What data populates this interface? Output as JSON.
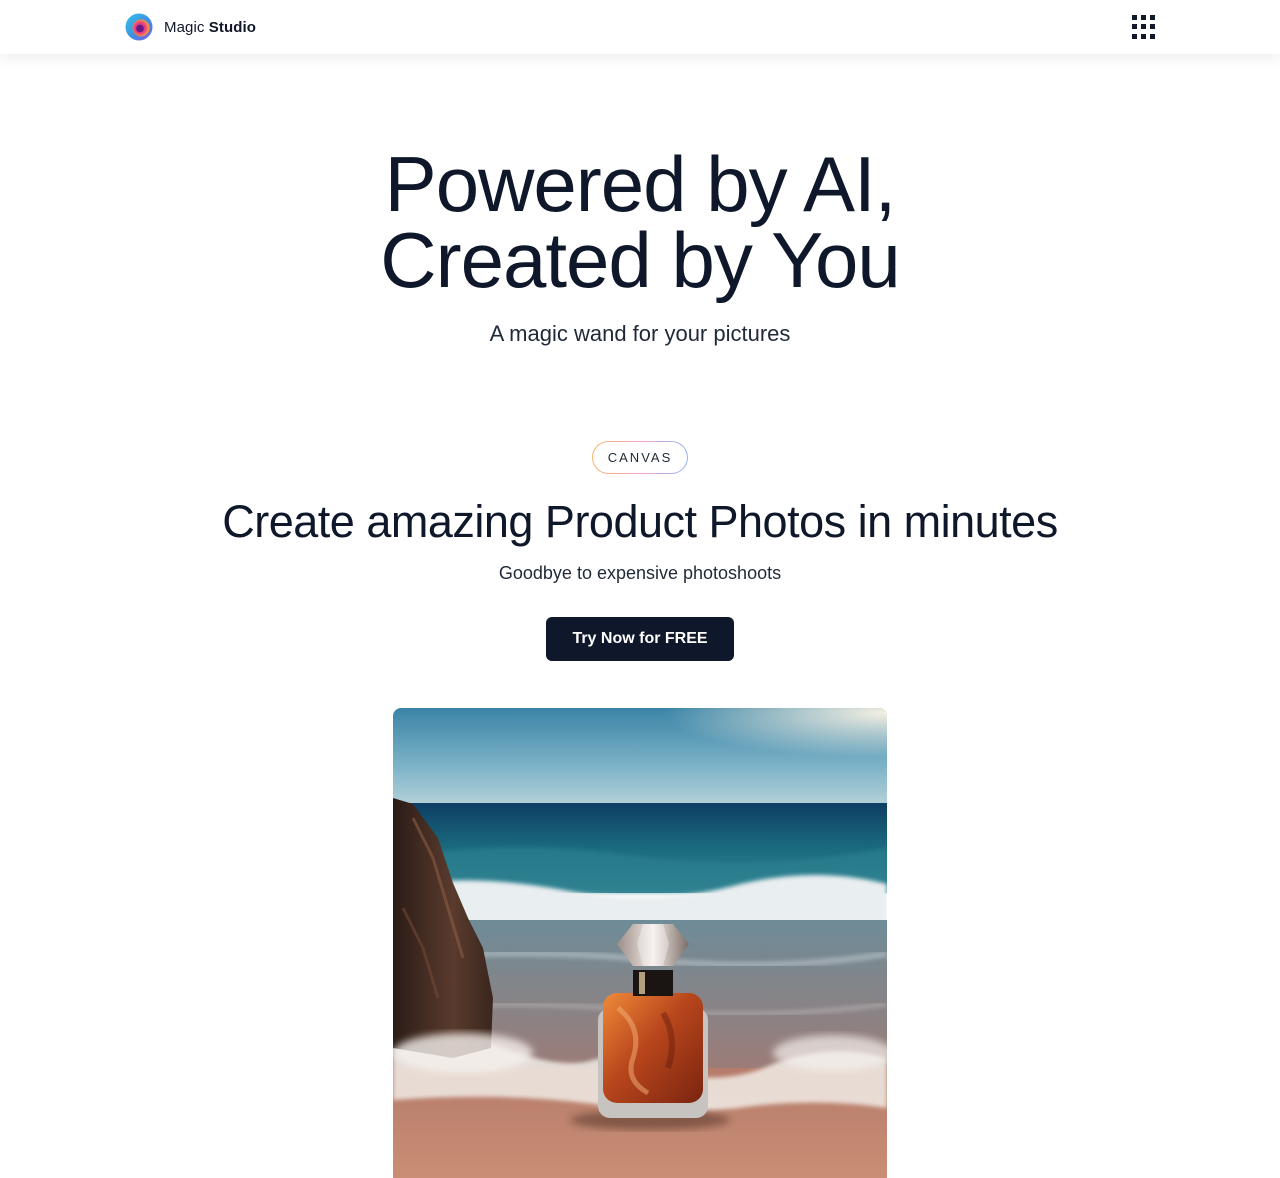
{
  "header": {
    "brand": {
      "name_regular": "Magic",
      "name_bold": "Studio",
      "logo_icon": "magic-studio-logo-icon"
    },
    "apps_icon": "grid-menu-icon"
  },
  "hero": {
    "title_line1": "Powered by AI,",
    "title_line2": "Created by You",
    "subtitle": "A magic wand for your pictures"
  },
  "feature": {
    "tag": "CANVAS",
    "title": "Create amazing Product Photos in minutes",
    "subtitle": "Goodbye to expensive photoshoots",
    "cta_label": "Try Now for FREE",
    "image": "perfume-bottle-on-beach-photo"
  },
  "colors": {
    "text": "#0f172a",
    "button_bg": "#0f172a",
    "button_text": "#ffffff",
    "pill_gradient": [
      "#f6b26b",
      "#f7a3c9",
      "#8ab4f8"
    ]
  }
}
